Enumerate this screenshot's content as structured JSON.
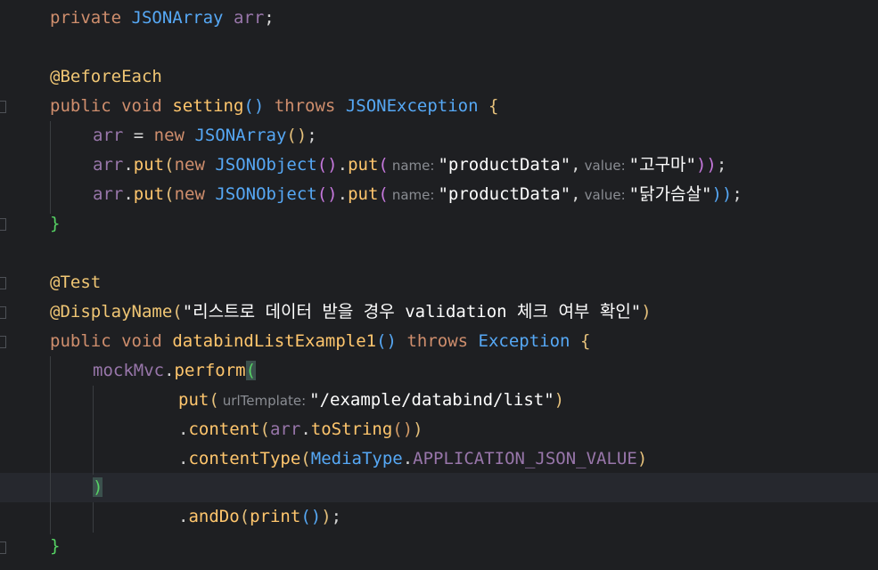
{
  "code": {
    "l1": {
      "kw": "private",
      "type": "JSONArray",
      "field": "arr",
      "end": ";"
    },
    "l3": {
      "ann": "@BeforeEach"
    },
    "l4": {
      "kw1": "public",
      "kw2": "void",
      "name": "setting",
      "paren": "()",
      "kw3": "throws",
      "type": "JSONException",
      "brace": "{"
    },
    "l5": {
      "field": "arr",
      "op": " = ",
      "kw": "new",
      "type": "JSONArray",
      "paren": "()",
      "end": ";"
    },
    "l6": {
      "field": "arr",
      "dot": ".",
      "method": "put",
      "p1": "(",
      "kw": "new",
      "type": "JSONObject",
      "p2": "()",
      "dot2": ".",
      "method2": "put",
      "p3": "(",
      "hint1": "name:",
      "str1": "\"productData\"",
      "comma": ",",
      "hint2": "value:",
      "str2": "\"고구마\"",
      "close": "))",
      "end": ";"
    },
    "l7": {
      "field": "arr",
      "dot": ".",
      "method": "put",
      "p1": "(",
      "kw": "new",
      "type": "JSONObject",
      "p2": "()",
      "dot2": ".",
      "method2": "put",
      "p3": "(",
      "hint1": "name:",
      "str1": "\"productData\"",
      "comma": ",",
      "hint2": "value:",
      "str2": "\"닭가슴살\"",
      "close": "))",
      "end": ";"
    },
    "l8": {
      "brace": "}"
    },
    "l10": {
      "ann": "@Test"
    },
    "l11": {
      "ann": "@DisplayName",
      "p1": "(",
      "str": "\"리스트로 데이터 받을 경우 validation 체크 여부 확인\"",
      "p2": ")"
    },
    "l12": {
      "kw1": "public",
      "kw2": "void",
      "name": "databindListExample1",
      "paren": "()",
      "kw3": "throws",
      "type": "Exception",
      "brace": "{"
    },
    "l13": {
      "field": "mockMvc",
      "dot": ".",
      "method": "perform",
      "p1": "("
    },
    "l14": {
      "method": "put",
      "p1": "(",
      "hint": "urlTemplate:",
      "str": "\"/example/databind/list\"",
      "p2": ")"
    },
    "l15": {
      "dot": ".",
      "method": "content",
      "p1": "(",
      "field": "arr",
      "dot2": ".",
      "method2": "toString",
      "p2": "()",
      "p3": ")"
    },
    "l16": {
      "dot": ".",
      "method": "contentType",
      "p1": "(",
      "type": "MediaType",
      "dot2": ".",
      "field": "APPLICATION_JSON_VALUE",
      "p2": ")"
    },
    "l17": {
      "p": ")"
    },
    "l18": {
      "dot": ".",
      "method": "andDo",
      "p1": "(",
      "method2": "print",
      "p2": "()",
      "p3": ")",
      "end": ";"
    },
    "l19": {
      "brace": "}"
    }
  },
  "colors": {
    "background": "#1e1f22",
    "keyword": "#cf8e6d",
    "type": "#56a8f5",
    "field": "#9876aa",
    "string": "#ffffff",
    "annotation": "#f0c674",
    "hint": "#8a8d93"
  }
}
